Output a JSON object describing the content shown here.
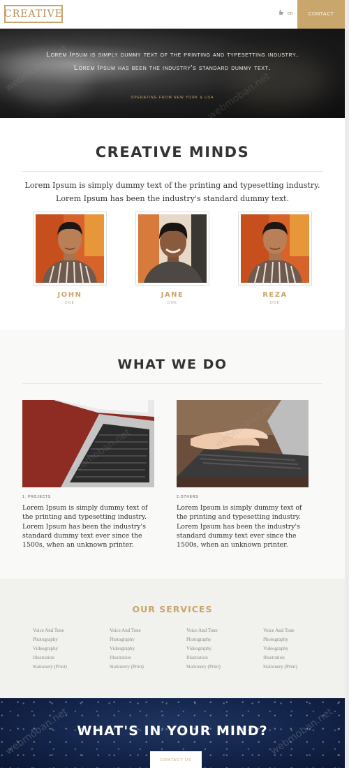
{
  "header": {
    "logo": "CREATIVE",
    "lang_fr": "fr",
    "lang_en": "en",
    "contact": "CONTACT"
  },
  "hero": {
    "text": "Lorem Ipsum is simply dummy text of the printing and typesetting industry. Lorem Ipsum has been the industry's standard dummy text.",
    "subtext": "OPERATING FROM NEW YORK & USA"
  },
  "minds": {
    "title": "CREATIVE MINDS",
    "intro": "Lorem Ipsum is simply dummy text of the printing and typesetting industry. Lorem Ipsum has been the industry's standard dummy text.",
    "members": [
      {
        "name": "JOHN",
        "role": "DOE"
      },
      {
        "name": "JANE",
        "role": "DOE"
      },
      {
        "name": "REZA",
        "role": "DOE"
      }
    ]
  },
  "whatwedo": {
    "title": "WHAT WE DO",
    "items": [
      {
        "caption": "1. PROJECTS",
        "desc": "Lorem Ipsum is simply dummy text of the printing and typesetting industry. Lorem Ipsum has been the industry's standard dummy text ever since the 1500s, when an unknown printer."
      },
      {
        "caption": "2.OTHERS",
        "desc": "Lorem Ipsum is simply dummy text of the printing and typesetting industry. Lorem Ipsum has been the industry's standard dummy text ever since the 1500s, when an unknown printer."
      }
    ]
  },
  "services": {
    "title": "OUR SERVICES",
    "columns": [
      [
        "Voice And Tone",
        "Photography",
        "Videography",
        "Illustration",
        "Stationery (Print)"
      ],
      [
        "Voice And Tone",
        "Photography",
        "Videography",
        "Illustration",
        "Stationery (Print)"
      ],
      [
        "Voice And Tone",
        "Photography",
        "Videography",
        "Illustration",
        "Stationery (Print)"
      ],
      [
        "Voice And Tone",
        "Photography",
        "Videography",
        "Illustration",
        "Stationery (Print)"
      ]
    ]
  },
  "mind": {
    "title": "WHAT'S IN YOUR MIND?",
    "button": "CONTACT US"
  },
  "watermark": "webmoban.net",
  "colors": {
    "accent": "#c9a66b",
    "text": "#333333",
    "services_bg": "#f1f1ed",
    "mind_bg": "#13244a"
  }
}
